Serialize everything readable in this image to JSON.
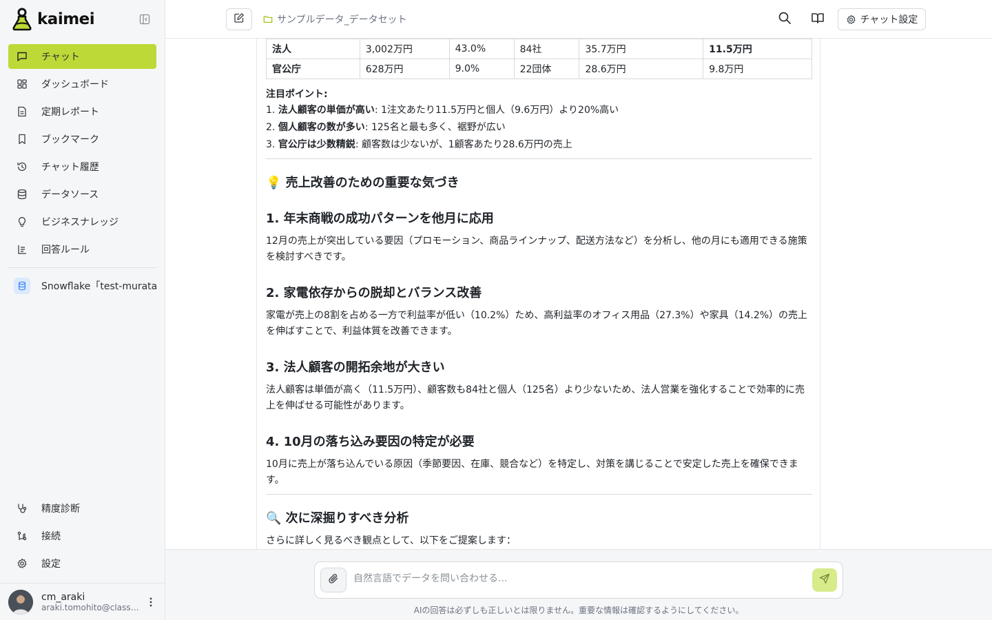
{
  "brand": {
    "name": "kaimei"
  },
  "sidebar": {
    "items": [
      {
        "label": "チャット",
        "icon": "chat-icon",
        "active": true
      },
      {
        "label": "ダッシュボード",
        "icon": "dashboard-icon"
      },
      {
        "label": "定期レポート",
        "icon": "report-icon"
      },
      {
        "label": "ブックマーク",
        "icon": "bookmark-icon"
      },
      {
        "label": "チャット履歴",
        "icon": "history-icon"
      },
      {
        "label": "データソース",
        "icon": "database-icon"
      },
      {
        "label": "ビジネスナレッジ",
        "icon": "lightbulb-icon"
      },
      {
        "label": "回答ルール",
        "icon": "rules-icon"
      }
    ],
    "datasource": {
      "label": "Snowflake「test-murata」"
    },
    "bottom_items": [
      {
        "label": "精度診断",
        "icon": "stethoscope-icon"
      },
      {
        "label": "接続",
        "icon": "connection-icon"
      },
      {
        "label": "設定",
        "icon": "gear-icon"
      }
    ],
    "user": {
      "name": "cm_araki",
      "email": "araki.tomohito@classmethod.jp"
    }
  },
  "header": {
    "dataset": "サンプルデータ_データセット",
    "settings_label": "チャット設定"
  },
  "main": {
    "table_rows": [
      [
        "法人",
        "3,002万円",
        "43.0%",
        "84社",
        "35.7万円",
        "11.5万円"
      ],
      [
        "官公庁",
        "628万円",
        "9.0%",
        "22団体",
        "28.6万円",
        "9.8万円"
      ]
    ],
    "notes_title": "注目ポイント:",
    "notes": [
      {
        "num": "1.",
        "bold": "法人顧客の単価が高い",
        "text": ": 1注文あたり11.5万円と個人（9.6万円）より20%高い"
      },
      {
        "num": "2.",
        "bold": "個人顧客の数が多い",
        "text": ": 125名と最も多く、裾野が広い"
      },
      {
        "num": "3.",
        "bold": "官公庁は少数精鋭",
        "text": ": 顧客数は少ないが、1顧客あたり28.6万円の売上"
      }
    ],
    "insights_title": "💡 売上改善のための重要な気づき",
    "insights": [
      {
        "title": "1. 年末商戦の成功パターンを他月に応用",
        "body": "12月の売上が突出している要因（プロモーション、商品ラインナップ、配送方法など）を分析し、他の月にも適用できる施策を検討すべきです。"
      },
      {
        "title": "2. 家電依存からの脱却とバランス改善",
        "body": "家電が売上の8割を占める一方で利益率が低い（10.2%）ため、高利益率のオフィス用品（27.3%）や家具（14.2%）の売上を伸ばすことで、利益体質を改善できます。"
      },
      {
        "title": "3. 法人顧客の開拓余地が大きい",
        "body": "法人顧客は単価が高く（11.5万円）、顧客数も84社と個人（125名）より少ないため、法人営業を強化することで効率的に売上を伸ばせる可能性があります。"
      },
      {
        "title": "4. 10月の落ち込み要因の特定が必要",
        "body": "10月に売上が落ち込んでいる原因（季節要因、在庫、競合など）を特定し、対策を講じることで安定した売上を確保できます。"
      }
    ],
    "next_title": "🔍 次に深掘りすべき分析",
    "next_intro": "さらに詳しく見るべき観点として、以下をご提案します："
  },
  "input": {
    "placeholder": "自然言語でデータを問い合わせる...",
    "disclaimer": "AIの回答は必ずしも正しいとは限りません。重要な情報は確認するようにしてください。"
  },
  "colors": {
    "accent": "#bcd938",
    "send": "#d6eb8a"
  }
}
